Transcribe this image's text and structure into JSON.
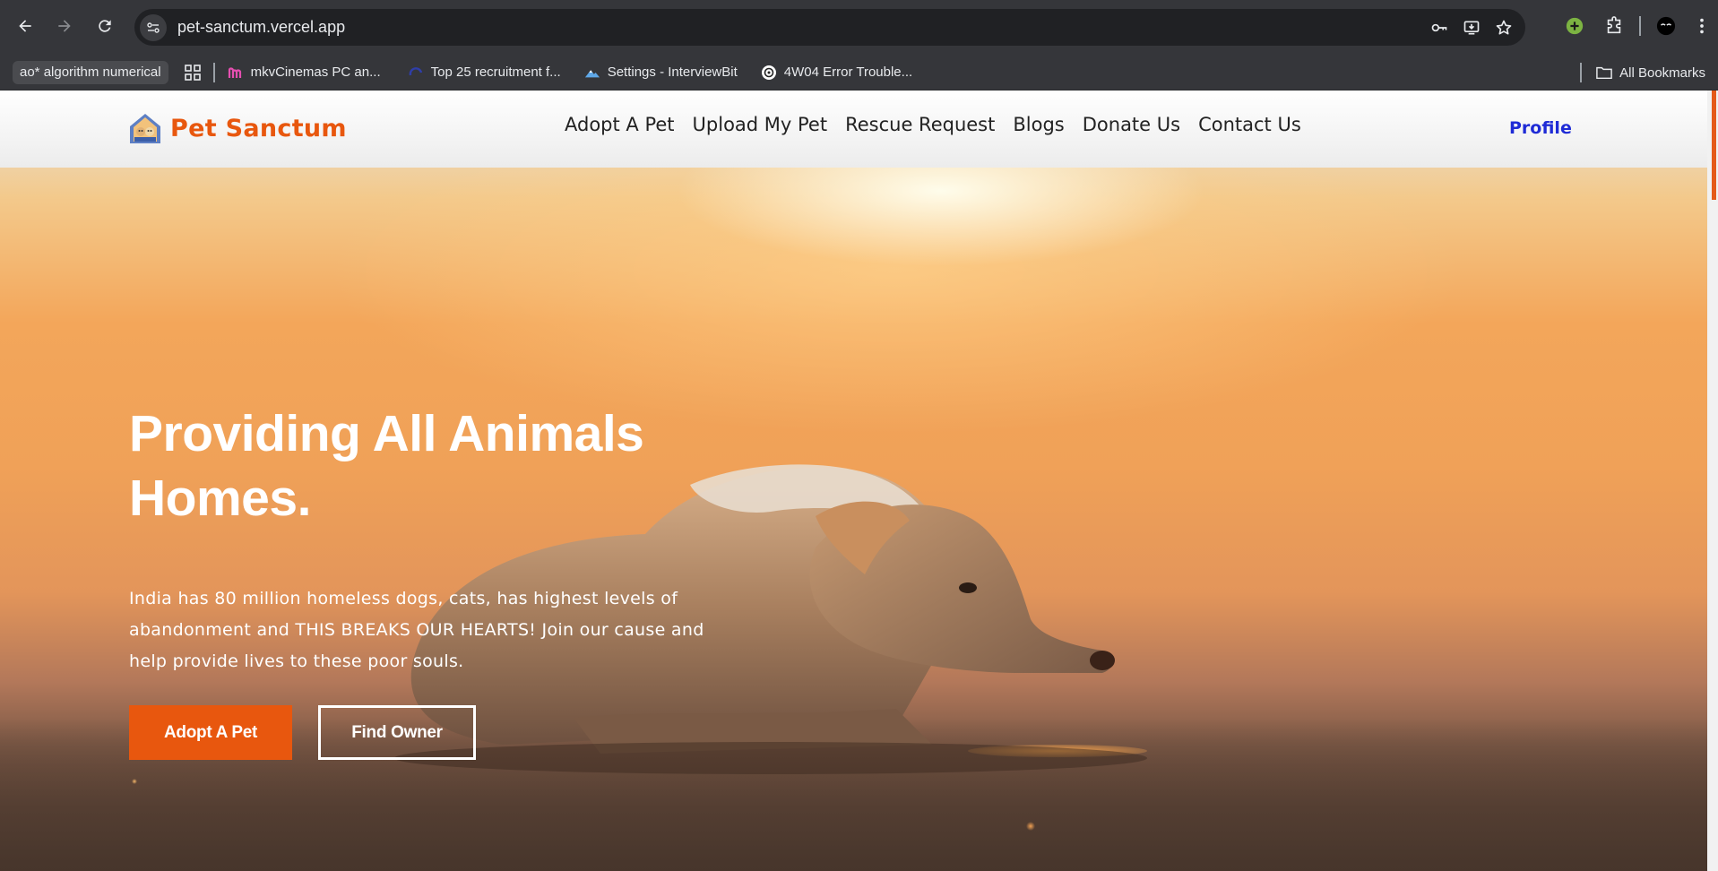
{
  "browser": {
    "url": "pet-sanctum.vercel.app",
    "bookmarks": [
      {
        "label": "ao* algorithm numerical",
        "icon": "chip"
      },
      {
        "label": "mkvCinemas PC an...",
        "icon": "m-logo-icon"
      },
      {
        "label": "Top 25 recruitment f...",
        "icon": "crescent-icon"
      },
      {
        "label": "Settings - InterviewBit",
        "icon": "mountain-icon"
      },
      {
        "label": "4W04 Error Trouble...",
        "icon": "openai-icon"
      }
    ],
    "all_bookmarks_label": "All Bookmarks"
  },
  "site": {
    "logo_text": "Pet Sanctum",
    "nav": [
      "Adopt A Pet",
      "Upload My Pet",
      "Rescue Request",
      "Blogs",
      "Donate Us",
      "Contact Us"
    ],
    "profile_label": "Profile",
    "brand_color": "#e8570e",
    "profile_color": "#1f2bd6"
  },
  "hero": {
    "title_line1": "Providing All Animals",
    "title_line2": "Homes.",
    "description": "India has 80 million homeless dogs, cats, has highest levels of abandonment and THIS BREAKS OUR HEARTS! Join our cause and help provide lives to these poor souls.",
    "primary_button": "Adopt A Pet",
    "secondary_button": "Find Owner"
  }
}
